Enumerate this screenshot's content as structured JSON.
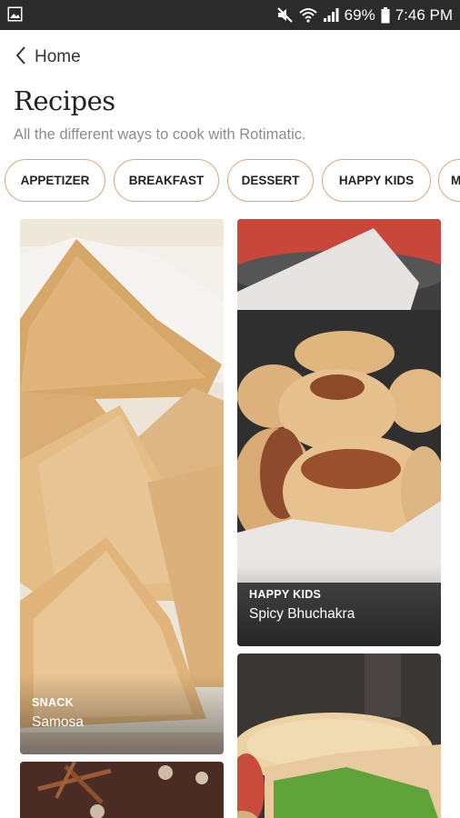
{
  "status_bar": {
    "battery_percent": "69%",
    "time": "7:46 PM",
    "icons": [
      "image-notification-icon",
      "mute-icon",
      "wifi-icon",
      "signal-icon",
      "battery-icon"
    ]
  },
  "nav": {
    "back_label": "Home",
    "back_icon": "chevron-left-icon"
  },
  "header": {
    "title": "Recipes",
    "subtitle": "All the different ways to cook with Rotimatic."
  },
  "categories": [
    {
      "label": "APPETIZER"
    },
    {
      "label": "BREAKFAST"
    },
    {
      "label": "DESSERT"
    },
    {
      "label": "HAPPY KIDS"
    },
    {
      "label": "M"
    }
  ],
  "recipes": [
    {
      "category": "SNACK",
      "name": "Samosa"
    },
    {
      "category": "HAPPY KIDS",
      "name": "Spicy Bhuchakra"
    },
    {
      "category": "",
      "name": ""
    },
    {
      "category": "",
      "name": ""
    }
  ],
  "colors": {
    "status_bar_bg": "#2b2b2b",
    "chip_border": "#d9a77a",
    "title_text": "#222222",
    "subtitle_text": "#8c8c8c"
  }
}
